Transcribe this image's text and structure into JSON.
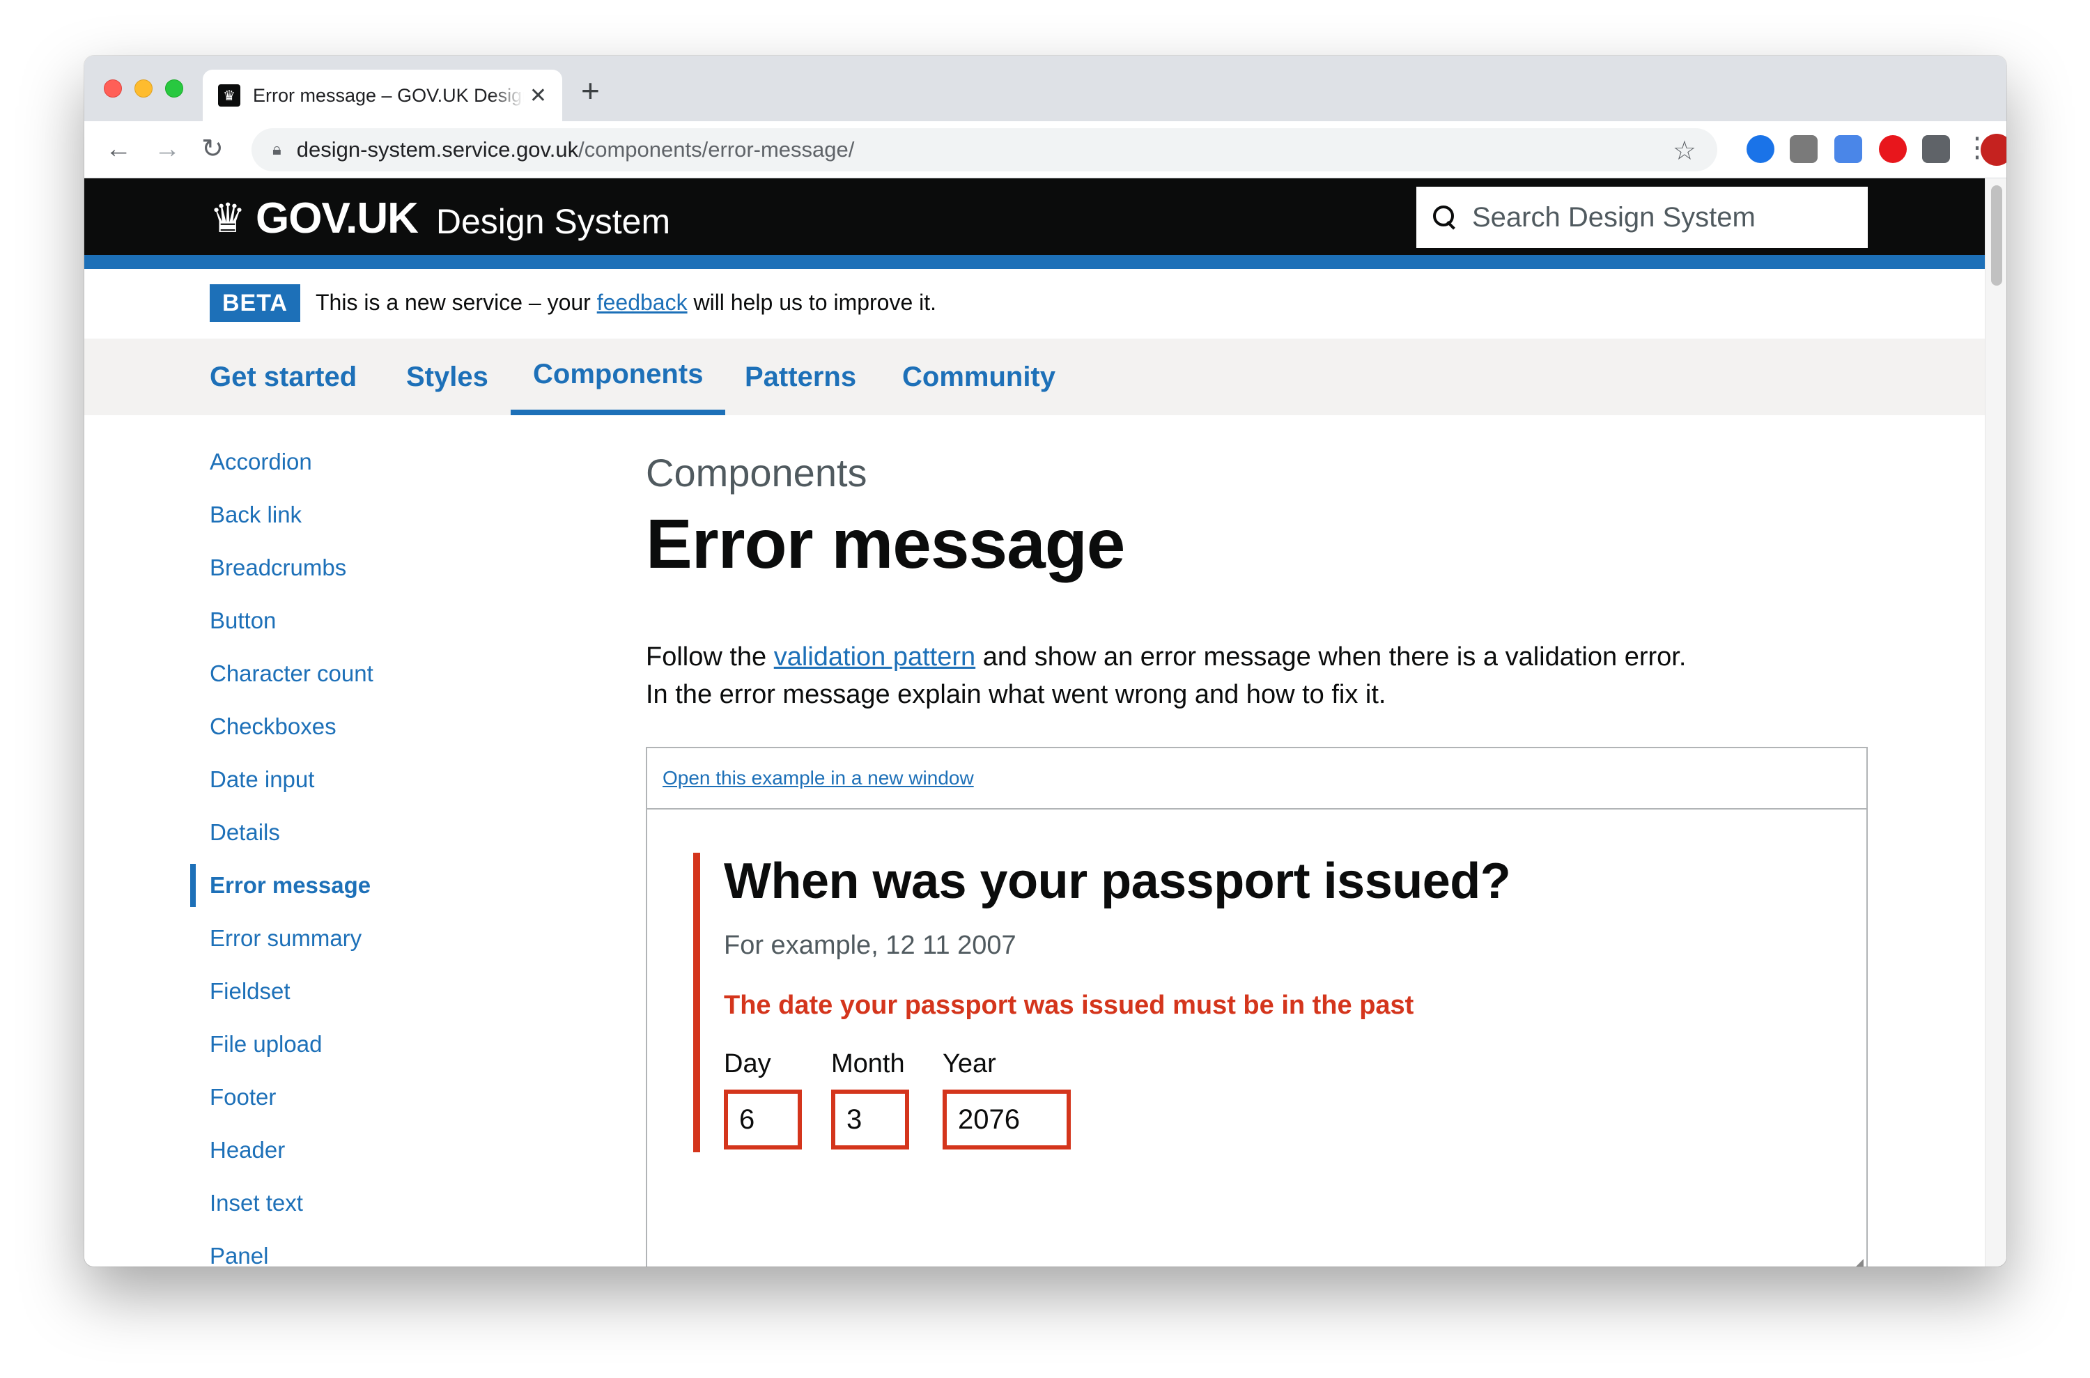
{
  "browser": {
    "tab_title": "Error message – GOV.UK Design System",
    "tab_close": "✕",
    "new_tab": "+",
    "url_host": "design-system.service.gov.uk",
    "url_path": "/components/error-message/"
  },
  "header": {
    "logo": "GOV.UK",
    "product": "Design System",
    "search_placeholder": "Search Design System"
  },
  "beta": {
    "tag": "BETA",
    "text_before": "This is a new service – your ",
    "link": "feedback",
    "text_after": " will help us to improve it."
  },
  "nav": {
    "items": [
      "Get started",
      "Styles",
      "Components",
      "Patterns",
      "Community"
    ],
    "active": "Components"
  },
  "sidebar": {
    "items": [
      "Accordion",
      "Back link",
      "Breadcrumbs",
      "Button",
      "Character count",
      "Checkboxes",
      "Date input",
      "Details",
      "Error message",
      "Error summary",
      "Fieldset",
      "File upload",
      "Footer",
      "Header",
      "Inset text",
      "Panel"
    ],
    "active": "Error message"
  },
  "main": {
    "caption": "Components",
    "title": "Error message",
    "lede_1_before": "Follow the ",
    "lede_1_link": "validation pattern",
    "lede_1_after": " and show an error message when there is a validation error.",
    "lede_2": "In the error message explain what went wrong and how to fix it."
  },
  "example": {
    "open_link": "Open this example in a new window",
    "question": "When was your passport issued?",
    "hint": "For example, 12 11 2007",
    "error": "The date your passport was issued must be in the past",
    "day_label": "Day",
    "month_label": "Month",
    "year_label": "Year",
    "day_value": "6",
    "month_value": "3",
    "year_value": "2076"
  },
  "colors": {
    "brand_blue": "#1d70b8",
    "error_red": "#d4351c",
    "header_black": "#0b0c0c"
  }
}
